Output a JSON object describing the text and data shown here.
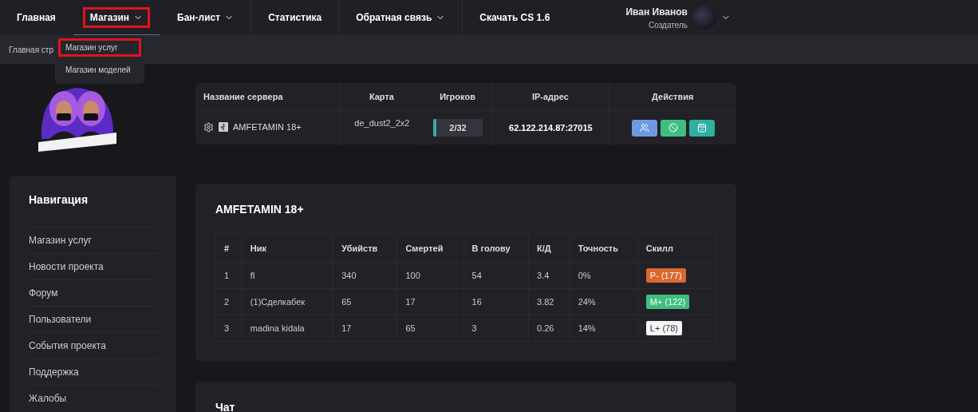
{
  "top_nav": {
    "items": [
      {
        "label": "Главная",
        "has_caret": false,
        "expanded": false,
        "highlighted": false,
        "divider_after": false
      },
      {
        "label": "Магазин",
        "has_caret": true,
        "expanded": true,
        "highlighted": true,
        "divider_after": false
      },
      {
        "label": "Бан-лист",
        "has_caret": true,
        "expanded": false,
        "highlighted": false,
        "divider_after": true
      },
      {
        "label": "Статистика",
        "has_caret": false,
        "expanded": false,
        "highlighted": false,
        "divider_after": true
      },
      {
        "label": "Обратная связь",
        "has_caret": true,
        "expanded": false,
        "highlighted": false,
        "divider_after": true
      },
      {
        "label": "Скачать CS 1.6",
        "has_caret": false,
        "expanded": false,
        "highlighted": false,
        "divider_after": false
      }
    ],
    "user": {
      "name": "Иван Иванов",
      "role": "Создатель"
    }
  },
  "dropdown": {
    "items": [
      {
        "label": "Магазин услуг",
        "highlighted": true
      },
      {
        "label": "Магазин моделей",
        "highlighted": false
      }
    ]
  },
  "breadcrumb": "Главная стр",
  "navigation": {
    "title": "Навигация",
    "items": [
      "Магазин услуг",
      "Новости проекта",
      "Форум",
      "Пользователи",
      "События проекта",
      "Поддержка",
      "Жалобы"
    ]
  },
  "server_table": {
    "columns": [
      "Название сервера",
      "Карта",
      "Игроков",
      "IP-адрес",
      "Действия"
    ],
    "rows": [
      {
        "name": "AMFETAMIN 18+",
        "map": "de_dust2_2x2",
        "players": "2/32",
        "level": 0.0625,
        "ip": "62.122.214.87:27015"
      }
    ]
  },
  "stats": {
    "title": "AMFETAMIN 18+",
    "columns": [
      "#",
      "Ник",
      "Убийств",
      "Смертей",
      "В голову",
      "К/Д",
      "Точность",
      "Скилл"
    ],
    "rows": [
      {
        "cells": [
          "1",
          "fl",
          "340",
          "100",
          "54",
          "3.4",
          "0%"
        ],
        "skill": "P- (177)",
        "color": "#d9692f"
      },
      {
        "cells": [
          "2",
          "(1)Сделкабек",
          "65",
          "17",
          "16",
          "3.82",
          "24%"
        ],
        "skill": "M+ (122)",
        "color": "#3fbf7f"
      },
      {
        "cells": [
          "3",
          "madina kidala",
          "17",
          "65",
          "3",
          "0.26",
          "14%"
        ],
        "skill": "L+ (78)",
        "color": "#f5f5f5"
      }
    ]
  },
  "chat": {
    "title": "Чат"
  }
}
